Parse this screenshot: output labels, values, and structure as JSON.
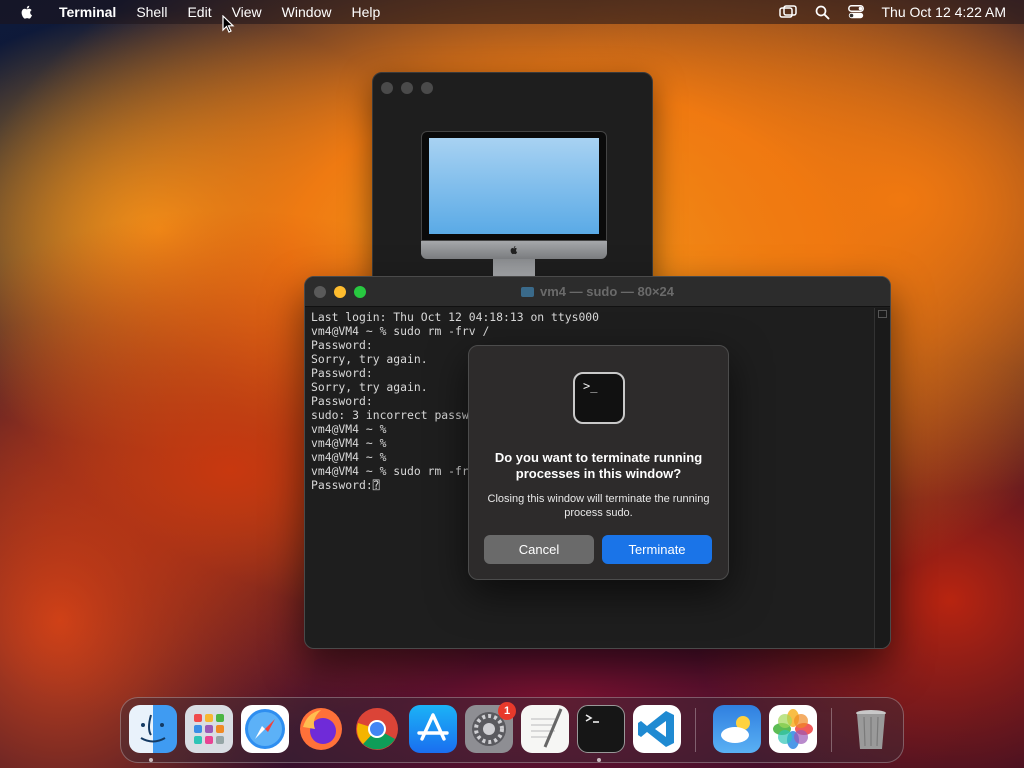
{
  "menubar": {
    "app": "Terminal",
    "items": [
      "Shell",
      "Edit",
      "View",
      "Window",
      "Help"
    ],
    "clock": "Thu Oct 12  4:22 AM"
  },
  "terminal": {
    "title": "vm4 — sudo — 80×24",
    "lines": [
      "Last login: Thu Oct 12 04:18:13 on ttys000",
      "vm4@VM4 ~ % sudo rm -frv /",
      "Password:",
      "Sorry, try again.",
      "Password:",
      "Sorry, try again.",
      "Password:",
      "sudo: 3 incorrect passw",
      "vm4@VM4 ~ %",
      "vm4@VM4 ~ %",
      "vm4@VM4 ~ %",
      "vm4@VM4 ~ % sudo rm -fr",
      "Password:⍰"
    ]
  },
  "dialog": {
    "heading": "Do you want to terminate running processes in this window?",
    "message": "Closing this window will terminate the running process sudo.",
    "cancel_label": "Cancel",
    "terminate_label": "Terminate",
    "icon_text": ">_"
  },
  "dock": {
    "items": [
      "finder-icon",
      "launchpad-icon",
      "safari-icon",
      "firefox-icon",
      "chrome-icon",
      "app-store-icon",
      "system-settings-icon",
      "textedit-icon",
      "terminal-icon",
      "vscode-icon",
      "weather-icon",
      "photos-icon",
      "trash-icon"
    ],
    "settings_badge": "1"
  },
  "colors": {
    "accent": "#1a74e8",
    "close": "#5a5a5a",
    "minimize": "#febc2e",
    "maximize": "#28c840"
  }
}
